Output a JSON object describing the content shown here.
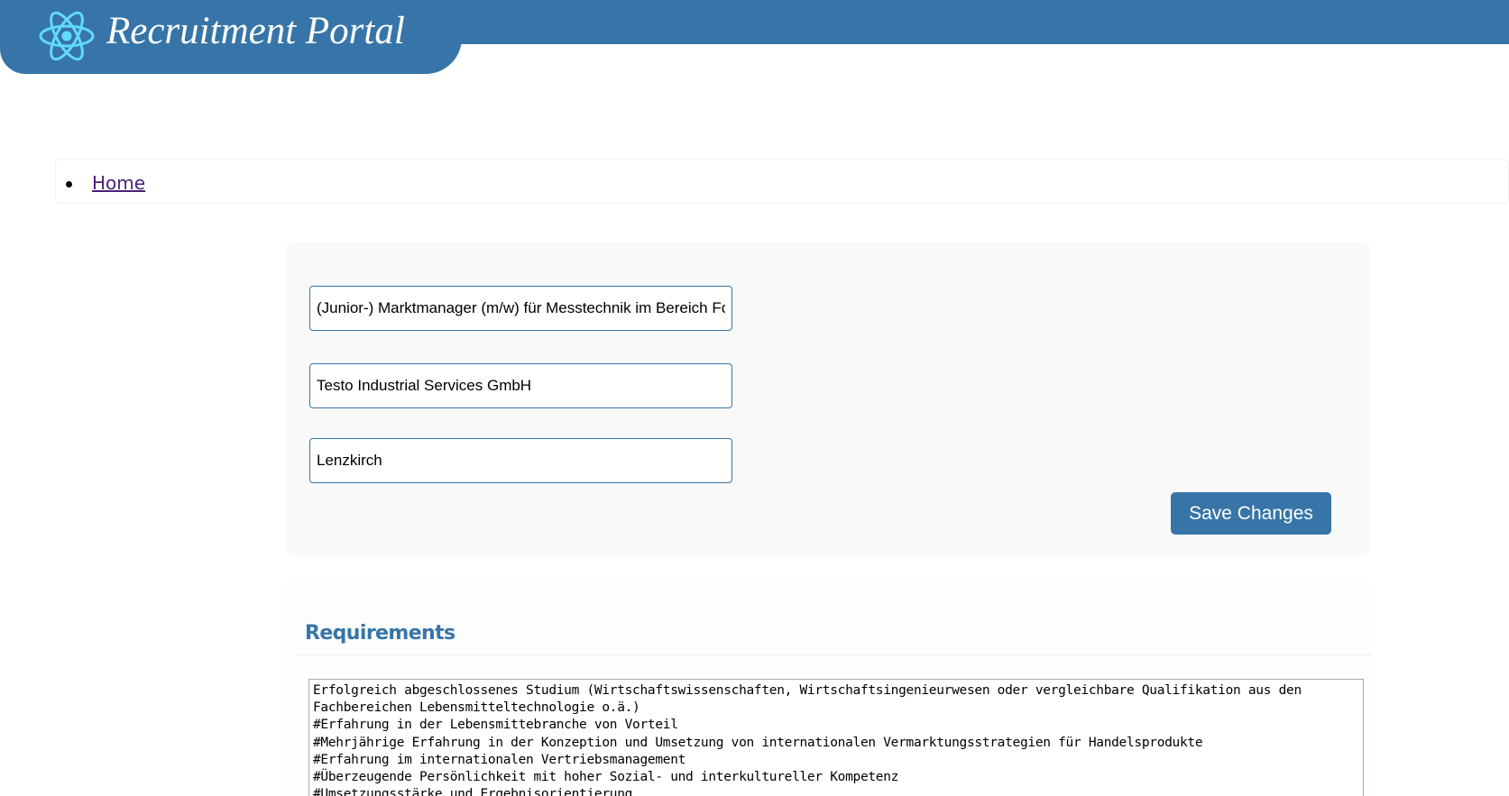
{
  "header": {
    "title": "Recruitment Portal",
    "logo_icon": "react-atom-icon",
    "color": "#3775a8",
    "logo_color": "#61dafb"
  },
  "breadcrumb": {
    "items": [
      {
        "label": "Home"
      }
    ]
  },
  "form": {
    "job_title": "(Junior-) Marktmanager (m/w) für Messtechnik im Bereich Food",
    "company": "Testo Industrial Services GmbH",
    "location": "Lenzkirch",
    "save_label": "Save Changes"
  },
  "requirements": {
    "heading": "Requirements",
    "text": "Erfolgreich abgeschlossenes Studium (Wirtschaftswissenschaften, Wirtschaftsingenieurwesen oder vergleichbare Qualifikation aus den Fachbereichen Lebensmitteltechnologie o.ä.)\n#Erfahrung in der Lebensmittebranche von Vorteil\n#Mehrjährige Erfahrung in der Konzeption und Umsetzung von internationalen Vermarktungsstrategien für Handelsprodukte\n#Erfahrung im internationalen Vertriebsmanagement\n#Überzeugende Persönlichkeit mit hoher Sozial- und interkultureller Kompetenz\n#Umsetzungsstärke und Ergebnisorientierung"
  }
}
